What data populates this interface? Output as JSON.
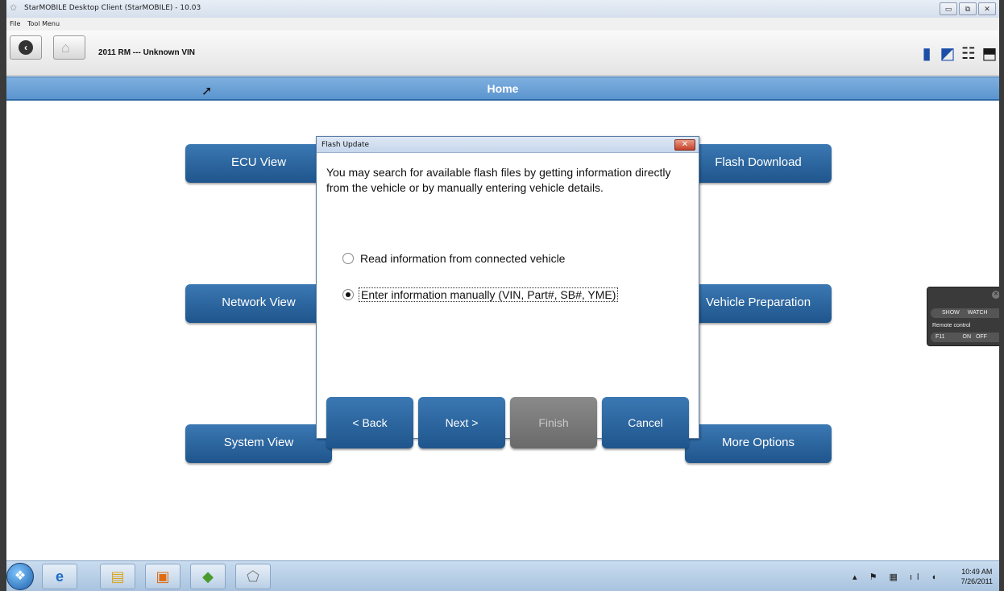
{
  "window": {
    "title": "StarMOBILE Desktop Client (StarMOBILE) - 10.03",
    "minimize": "▭",
    "restore": "⧉",
    "close": "✕"
  },
  "menubar": {
    "items": [
      "File",
      "Tool Menu"
    ]
  },
  "toolbar": {
    "back_icon": "back-arrow-icon",
    "home_icon": "home-icon",
    "vehicle_info": "2011  RM  ---  Unknown VIN",
    "status_icons": [
      "battery-icon",
      "signal-icon",
      "network-icon",
      "connector-icon"
    ]
  },
  "header": {
    "title": "Home"
  },
  "main_buttons": {
    "ecu_view": "ECU View",
    "flash_download": "Flash Download",
    "network_view": "Network View",
    "vehicle_preparation": "Vehicle Preparation",
    "system_view": "System View",
    "more_options": "More Options"
  },
  "remote_widget": {
    "show_label": "SHOW",
    "watch_label": "WATCH",
    "remote_control_label": "Remote control",
    "key_label": "F11",
    "on_label": "ON",
    "off_label": "OFF"
  },
  "dialog": {
    "title": "Flash Update",
    "message": "You may search for available flash files by getting information directly from the vehicle or by manually entering vehicle details.",
    "options": [
      {
        "label": "Read information from connected vehicle",
        "selected": false
      },
      {
        "label": "Enter information manually (VIN, Part#, SB#, YME)",
        "selected": true
      }
    ],
    "buttons": {
      "back": "< Back",
      "next": "Next >",
      "finish": "Finish",
      "cancel": "Cancel"
    },
    "finish_enabled": false
  },
  "taskbar": {
    "items": [
      "start-orb",
      "internet-explorer-icon",
      "folder-icon",
      "media-player-icon",
      "app-icon",
      "starmobile-icon"
    ],
    "time": "10:49 AM",
    "date": "7/26/2011"
  },
  "colors": {
    "accent_blue": "#1f558c",
    "header_blue": "#5b95cf",
    "disabled_gray": "#6a6a6a"
  }
}
